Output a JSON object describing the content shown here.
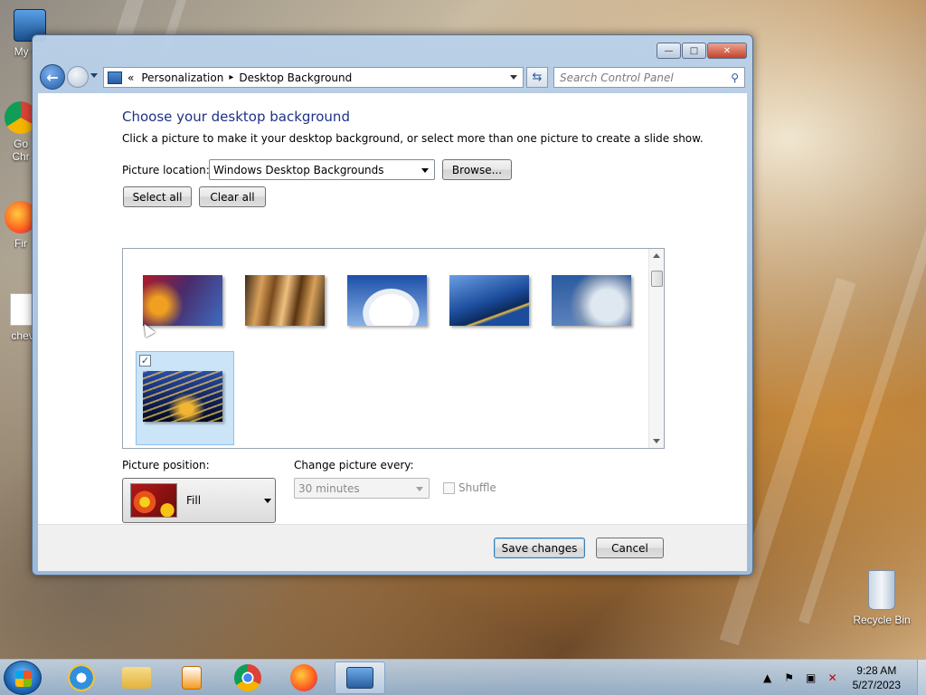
{
  "desktop": {
    "icons": [
      {
        "label": "My Co"
      },
      {
        "label": "Go\nChr"
      },
      {
        "label": "Fir"
      },
      {
        "label": "chev"
      },
      {
        "label": "Recycle Bin"
      }
    ]
  },
  "window": {
    "caption_buttons": {
      "minimize": "—",
      "maximize": "□",
      "close": "✕"
    },
    "breadcrumb": {
      "prefix": "«",
      "items": [
        "Personalization",
        "Desktop Background"
      ],
      "separator": "▸"
    },
    "search": {
      "placeholder": "Search Control Panel"
    },
    "heading": "Choose your desktop background",
    "subtext": "Click a picture to make it your desktop background, or select more than one picture to create a slide show.",
    "picture_location": {
      "label": "Picture location:",
      "value": "Windows Desktop Backgrounds",
      "browse_label": "Browse..."
    },
    "select_all_label": "Select all",
    "clear_all_label": "Clear all",
    "gallery": {
      "thumbnails": [
        {
          "name": "tower",
          "selected": false,
          "colors": [
            "#b01a2a",
            "#3d6cc2",
            "#f0a020"
          ]
        },
        {
          "name": "metal-folds",
          "selected": false,
          "colors": [
            "#7a4a1e",
            "#d8a05a",
            "#3a2a1a"
          ]
        },
        {
          "name": "white-building",
          "selected": false,
          "colors": [
            "#1d4fa8",
            "#e8eef5",
            "#8ab2e6"
          ]
        },
        {
          "name": "blue-structure",
          "selected": false,
          "colors": [
            "#1c4c9c",
            "#6ba0e4",
            "#f0c040"
          ]
        },
        {
          "name": "dotted-dome",
          "selected": false,
          "colors": [
            "#2a5aa0",
            "#c5d3e5",
            "#7d93b5"
          ]
        },
        {
          "name": "night-arches",
          "selected": true,
          "colors": [
            "#0b1a4d",
            "#f2b531",
            "#2a4da8"
          ]
        }
      ]
    },
    "picture_position": {
      "label": "Picture position:",
      "value": "Fill"
    },
    "change_picture": {
      "label": "Change picture every:",
      "value": "30 minutes"
    },
    "shuffle_label": "Shuffle",
    "save_label": "Save changes",
    "cancel_label": "Cancel"
  },
  "taskbar": {
    "items": [
      "start",
      "internet-explorer",
      "windows-explorer",
      "media-player",
      "chrome",
      "firefox",
      "control-panel"
    ],
    "active": "control-panel",
    "clock": {
      "time": "9:28 AM",
      "date": "5/27/2023"
    }
  }
}
